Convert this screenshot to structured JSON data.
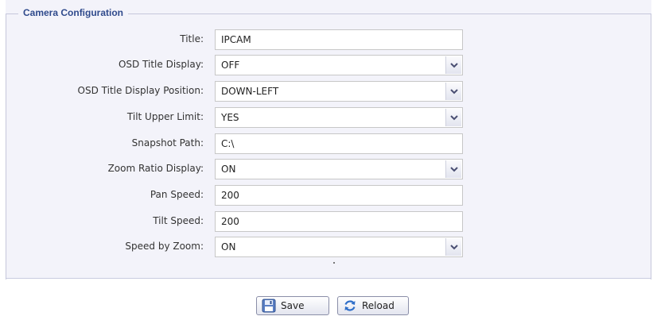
{
  "section": {
    "legend": "Camera Configuration"
  },
  "fields": [
    {
      "label": "Title:",
      "value": "IPCAM",
      "type": "text"
    },
    {
      "label": "OSD Title Display:",
      "value": "OFF",
      "type": "select"
    },
    {
      "label": "OSD Title Display Position:",
      "value": "DOWN-LEFT",
      "type": "select"
    },
    {
      "label": "Tilt Upper Limit:",
      "value": "YES",
      "type": "select"
    },
    {
      "label": "Snapshot Path:",
      "value": "C:\\",
      "type": "text"
    },
    {
      "label": "Zoom Ratio Display:",
      "value": "ON",
      "type": "select"
    },
    {
      "label": "Pan Speed:",
      "value": "200",
      "type": "text"
    },
    {
      "label": "Tilt Speed:",
      "value": "200",
      "type": "text"
    },
    {
      "label": "Speed by Zoom:",
      "value": "ON",
      "type": "select"
    }
  ],
  "buttons": {
    "save_label": "Save",
    "reload_label": "Reload"
  },
  "icons": {
    "save": "floppy-disk-icon",
    "reload": "reload-arrows-icon",
    "dropdown": "chevron-down-icon"
  },
  "colors": {
    "legend_text": "#2f4a8c",
    "panel_bg": "#f3f3fa",
    "border": "#c5c7dc"
  }
}
